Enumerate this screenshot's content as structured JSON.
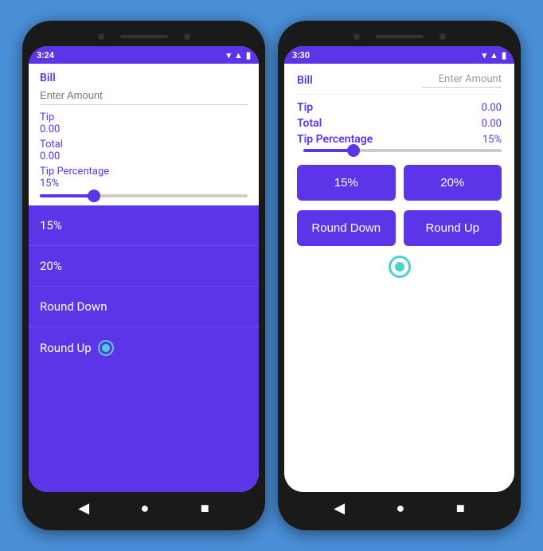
{
  "left_phone": {
    "status_bar": {
      "time": "3:24",
      "icons": [
        "location",
        "settings",
        "shield",
        "battery"
      ]
    },
    "bill_label": "Bill",
    "input_placeholder": "Enter Amount",
    "tip_label": "Tip",
    "tip_value": "0.00",
    "total_label": "Total",
    "total_value": "0.00",
    "tip_pct_label": "Tip Percentage",
    "tip_pct_value": "15%",
    "dropdown": {
      "items": [
        "15%",
        "20%",
        "Round Down",
        "Round Up"
      ]
    }
  },
  "right_phone": {
    "status_bar": {
      "time": "3:30",
      "icons": [
        "settings",
        "shield",
        "battery"
      ]
    },
    "bill_label": "Bill",
    "input_placeholder": "Enter Amount",
    "tip_label": "Tip",
    "tip_value": "0.00",
    "total_label": "Total",
    "total_value": "0.00",
    "tip_pct_label": "Tip Percentage",
    "tip_pct_value": "15%",
    "btn_15": "15%",
    "btn_20": "20%",
    "btn_round_down": "Round Down",
    "btn_round_up": "Round Up"
  },
  "nav": {
    "back": "◀",
    "home": "●",
    "recent": "■"
  }
}
